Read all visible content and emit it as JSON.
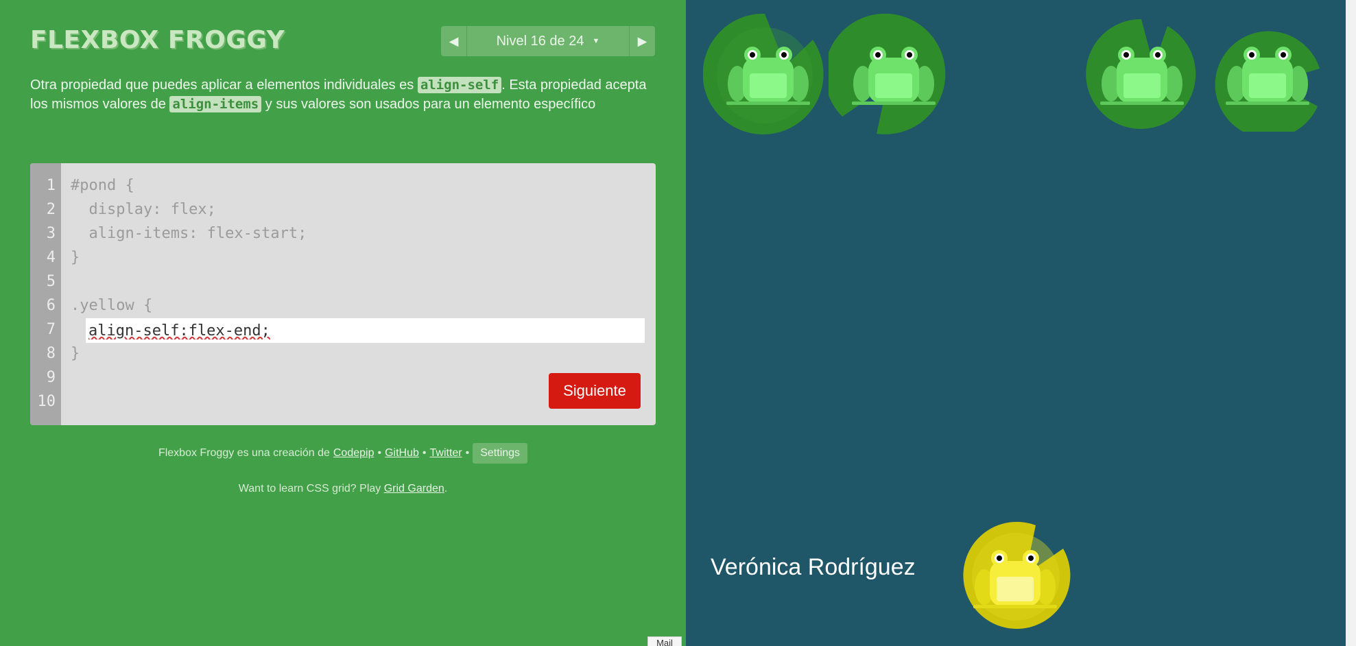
{
  "header": {
    "title": "FLEXBOX FROGGY",
    "level_label": "Nivel 16 de 24"
  },
  "instructions": {
    "part1": "Otra propiedad que puedes aplicar a elementos individuales es ",
    "code1": "align-self",
    "part2": ". Esta propiedad acepta los mismos valores de ",
    "code2": "align-items",
    "part3": " y sus valores son usados para un elemento específico"
  },
  "editor": {
    "line_numbers": [
      "1",
      "2",
      "3",
      "4",
      "5",
      "6",
      "7",
      "8",
      "9",
      "10"
    ],
    "lines": {
      "l1": "#pond {",
      "l2": "  display: flex;",
      "l3": "  align-items: flex-start;",
      "l4": "}",
      "l6": ".yellow {",
      "l8": "}"
    },
    "input_value": "align-self:flex-end;",
    "next_label": "Siguiente"
  },
  "footer": {
    "credit_text": "Flexbox Froggy es una creación de",
    "codepip": "Codepip",
    "github": "GitHub",
    "twitter": "Twitter",
    "settings": "Settings",
    "promo_text": "Want to learn CSS grid? Play",
    "grid_garden": "Grid Garden",
    "promo_end": "."
  },
  "pond": {
    "name": "Verónica Rodríguez",
    "colors": {
      "water": "#1f5768",
      "green_lily": "#2f8c2a",
      "green_frog": "#6fe26c",
      "yellow_lily": "#cfc50a",
      "yellow_frog": "#f6ee3a"
    }
  },
  "mail_tab": "Mail",
  "colors": {
    "sidebar": "#42a048",
    "next_button": "#d41a11"
  }
}
